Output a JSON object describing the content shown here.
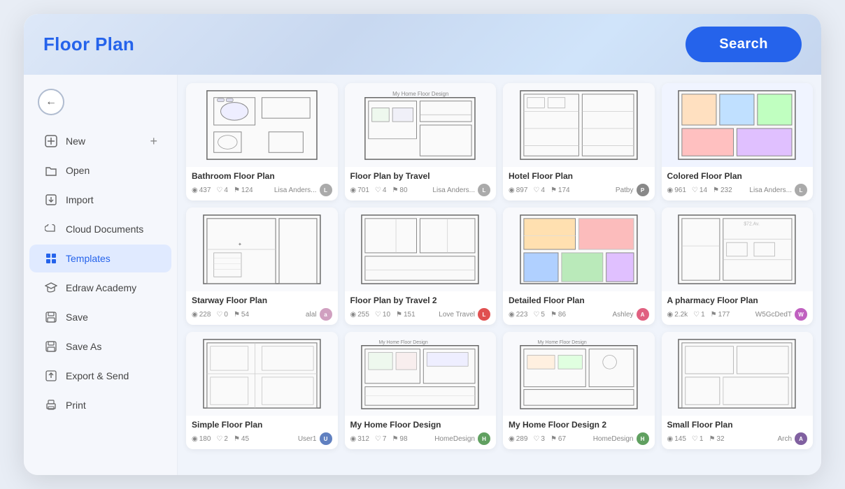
{
  "header": {
    "title": "Floor Plan",
    "search_label": "Search"
  },
  "sidebar": {
    "back_label": "←",
    "items": [
      {
        "id": "new",
        "label": "New",
        "icon": "➕",
        "active": false,
        "has_plus": true
      },
      {
        "id": "open",
        "label": "Open",
        "icon": "📁",
        "active": false
      },
      {
        "id": "import",
        "label": "Import",
        "icon": "📥",
        "active": false
      },
      {
        "id": "cloud",
        "label": "Cloud Documents",
        "icon": "☁️",
        "active": false
      },
      {
        "id": "templates",
        "label": "Templates",
        "icon": "🗂",
        "active": true
      },
      {
        "id": "academy",
        "label": "Edraw Academy",
        "icon": "🎓",
        "active": false
      },
      {
        "id": "save",
        "label": "Save",
        "icon": "💾",
        "active": false
      },
      {
        "id": "saveas",
        "label": "Save As",
        "icon": "💾",
        "active": false
      },
      {
        "id": "export",
        "label": "Export & Send",
        "icon": "📤",
        "active": false
      },
      {
        "id": "print",
        "label": "Print",
        "icon": "🖨",
        "active": false
      }
    ]
  },
  "templates": [
    {
      "id": "bathroom",
      "title": "Bathroom Floor Plan",
      "views": "437",
      "likes": "4",
      "comments": "124",
      "author": "Lisa Anders...",
      "author_color": "#a0a0a0",
      "type": "bathroom"
    },
    {
      "id": "travel",
      "title": "Floor Plan by Travel",
      "views": "701",
      "likes": "4",
      "comments": "80",
      "author": "Lisa Anders...",
      "author_color": "#a0a0a0",
      "type": "travel"
    },
    {
      "id": "hotel",
      "title": "Hotel Floor Plan",
      "views": "897",
      "likes": "4",
      "comments": "174",
      "author": "Patby",
      "author_color": "#888",
      "type": "hotel"
    },
    {
      "id": "colored",
      "title": "Colored Floor Plan",
      "views": "961",
      "likes": "14",
      "comments": "232",
      "author": "Lisa Anders...",
      "author_color": "#a0a0a0",
      "type": "colored"
    },
    {
      "id": "stairway",
      "title": "Starway Floor Plan",
      "views": "228",
      "likes": "0",
      "comments": "54",
      "author": "alal",
      "author_color": "#d0a0c0",
      "type": "stairway"
    },
    {
      "id": "myhome",
      "title": "Floor Plan by Travel 2",
      "views": "255",
      "likes": "10",
      "comments": "151",
      "author": "Love Travel",
      "author_color": "#e05050",
      "type": "myhome"
    },
    {
      "id": "detailed",
      "title": "Detailed Floor Plan",
      "views": "223",
      "likes": "5",
      "comments": "86",
      "author": "Ashley",
      "author_color": "#e06080",
      "type": "detailed"
    },
    {
      "id": "pharmacy",
      "title": "A pharmacy Floor Plan",
      "views": "2.2k",
      "likes": "1",
      "comments": "177",
      "author": "W5GcDedT",
      "author_color": "#c060c0",
      "type": "pharmacy"
    },
    {
      "id": "simple1",
      "title": "Simple Floor Plan",
      "views": "180",
      "likes": "2",
      "comments": "45",
      "author": "User1",
      "author_color": "#6080c0",
      "type": "simple1"
    },
    {
      "id": "myhome2",
      "title": "My Home Floor Design",
      "views": "312",
      "likes": "7",
      "comments": "98",
      "author": "HomeDesign",
      "author_color": "#60a060",
      "type": "myhome2"
    },
    {
      "id": "myhome3",
      "title": "My Home Floor Design 2",
      "views": "289",
      "likes": "3",
      "comments": "67",
      "author": "HomeDesign",
      "author_color": "#60a060",
      "type": "myhome3"
    },
    {
      "id": "small",
      "title": "Small Floor Plan",
      "views": "145",
      "likes": "1",
      "comments": "32",
      "author": "Arch",
      "author_color": "#8060a0",
      "type": "small"
    }
  ],
  "icons": {
    "eye": "👁",
    "heart": "♡",
    "comment": "💬",
    "views_sym": "◉",
    "likes_sym": "♡",
    "comments_sym": "⚐"
  }
}
